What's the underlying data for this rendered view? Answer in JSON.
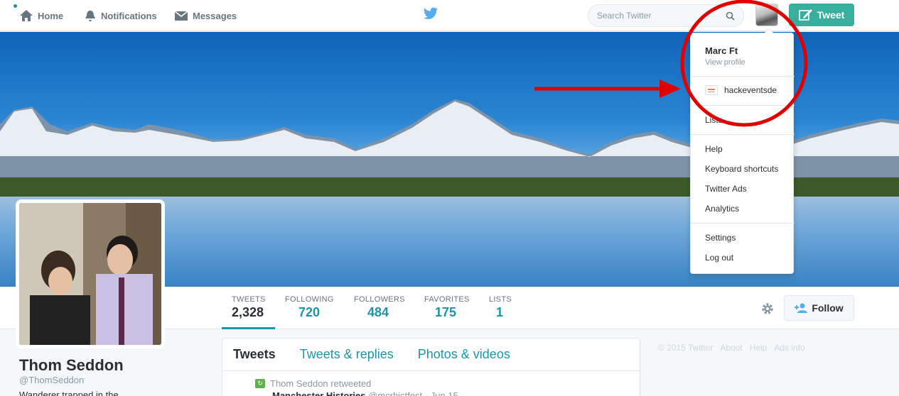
{
  "nav": {
    "home": "Home",
    "notifications": "Notifications",
    "messages": "Messages"
  },
  "search": {
    "placeholder": "Search Twitter"
  },
  "tweet_button": "Tweet",
  "menu": {
    "name": "Marc Ft",
    "view_profile": "View profile",
    "account": "hackeventsde",
    "lists": "Lists",
    "help": "Help",
    "keyboard_shortcuts": "Keyboard shortcuts",
    "twitter_ads": "Twitter Ads",
    "analytics": "Analytics",
    "settings": "Settings",
    "logout": "Log out"
  },
  "stats": [
    {
      "label": "TWEETS",
      "value": "2,328"
    },
    {
      "label": "FOLLOWING",
      "value": "720"
    },
    {
      "label": "FOLLOWERS",
      "value": "484"
    },
    {
      "label": "FAVORITES",
      "value": "175"
    },
    {
      "label": "LISTS",
      "value": "1"
    }
  ],
  "follow_button": "Follow",
  "profile": {
    "name": "Thom Seddon",
    "handle": "@ThomSeddon",
    "bio": "Wanderer trapped in the"
  },
  "timeline": {
    "tabs": [
      "Tweets",
      "Tweets & replies",
      "Photos & videos"
    ],
    "retweet_line": "Thom Seddon retweeted",
    "tweet_author": "Manchester Histories",
    "tweet_meta": "@mcrhistfest · Jun 15"
  },
  "footer": [
    "© 2015 Twitter",
    "About",
    "Help",
    "Ads info"
  ],
  "colors": {
    "accent": "#1b95a5",
    "tweet_button": "#3aae9e",
    "annotation": "#e00000"
  }
}
